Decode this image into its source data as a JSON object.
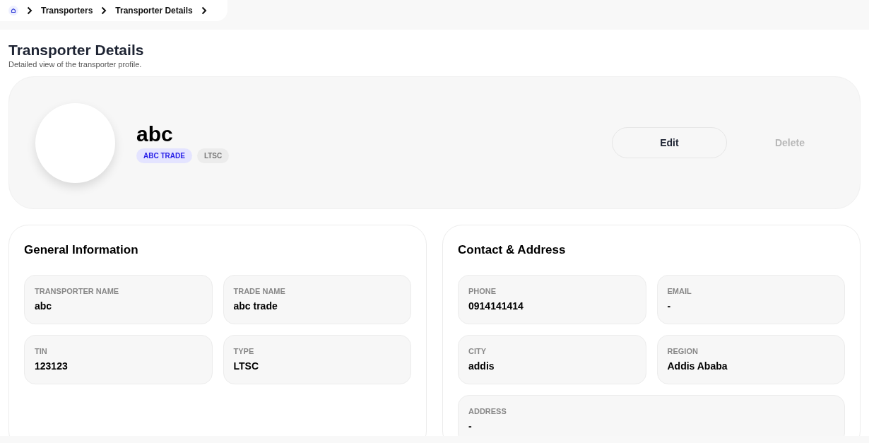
{
  "breadcrumb": {
    "items": [
      "Transporters",
      "Transporter Details"
    ]
  },
  "header": {
    "title": "Transporter Details",
    "subtitle": "Detailed view of the transporter profile."
  },
  "profile": {
    "name": "abc",
    "badges": [
      {
        "label": "ABC TRADE",
        "kind": "primary"
      },
      {
        "label": "LTSC",
        "kind": "neutral"
      }
    ],
    "actions": [
      {
        "label": "Edit",
        "kind": "outline"
      },
      {
        "label": "Delete",
        "kind": "danger"
      }
    ]
  },
  "sections": [
    {
      "title": "General Information",
      "fields": [
        {
          "label": "TRANSPORTER NAME",
          "value": "abc"
        },
        {
          "label": "TRADE NAME",
          "value": "abc trade"
        },
        {
          "label": "TIN",
          "value": "123123"
        },
        {
          "label": "TYPE",
          "value": "LTSC"
        }
      ]
    },
    {
      "title": "Contact & Address",
      "fields": [
        {
          "label": "PHONE",
          "value": "0914141414"
        },
        {
          "label": "EMAIL",
          "value": "-"
        },
        {
          "label": "CITY",
          "value": "addis"
        },
        {
          "label": "REGION",
          "value": "Addis Ababa"
        },
        {
          "label": "ADDRESS",
          "value": "-",
          "wide": true
        }
      ]
    }
  ]
}
